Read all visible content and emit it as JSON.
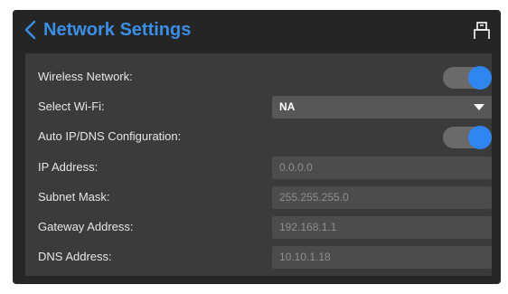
{
  "header": {
    "back_icon": "chevron-left-icon",
    "title": "Network Settings",
    "device_icon": "printer-icon",
    "accent_color": "#3a8ee6"
  },
  "settings": {
    "wireless_network": {
      "label": "Wireless Network:",
      "enabled": true
    },
    "select_wifi": {
      "label": "Select Wi-Fi:",
      "value": "NA"
    },
    "auto_ip_dns": {
      "label": "Auto IP/DNS Configuration:",
      "enabled": true
    },
    "ip_address": {
      "label": "IP Address:",
      "value": "0.0.0.0"
    },
    "subnet_mask": {
      "label": "Subnet Mask:",
      "value": "255.255.255.0"
    },
    "gateway_address": {
      "label": "Gateway Address:",
      "value": "192.168.1.1"
    },
    "dns_address": {
      "label": "DNS Address:",
      "value": "10.10.1.18"
    }
  },
  "colors": {
    "toggle_on": "#2f86f0",
    "panel_background": "#3b3b3b",
    "frame_background": "#262626"
  }
}
